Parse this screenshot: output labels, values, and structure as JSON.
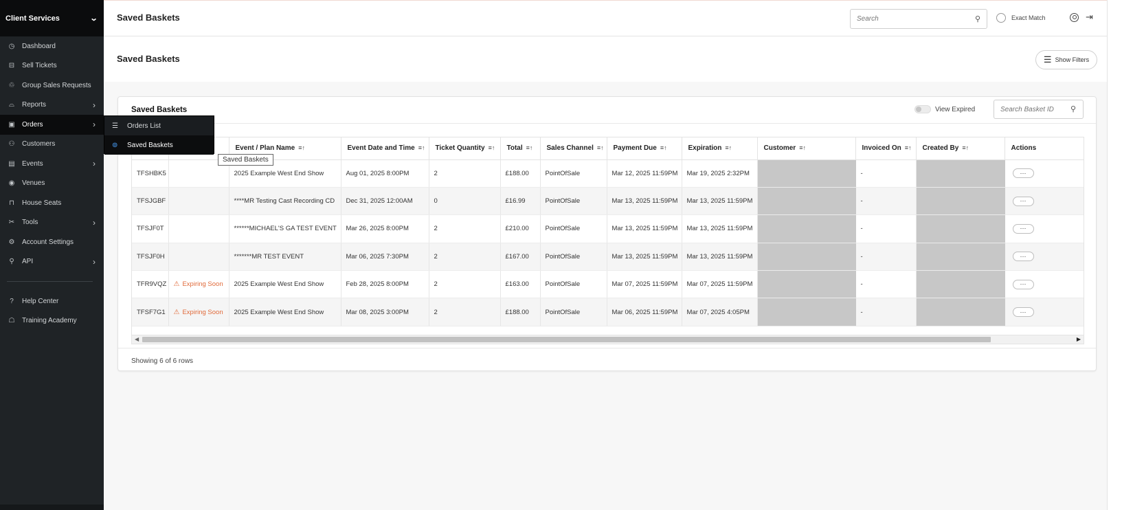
{
  "sidebar": {
    "header": "Client Services",
    "items": [
      {
        "label": "Dashboard",
        "icon": "dashboard-icon",
        "glyph": "◷",
        "arrow": false
      },
      {
        "label": "Sell Tickets",
        "icon": "ticket-icon",
        "glyph": "⊟",
        "arrow": false
      },
      {
        "label": "Group Sales Requests",
        "icon": "group-icon",
        "glyph": "♲",
        "arrow": false
      },
      {
        "label": "Reports",
        "icon": "chart-icon",
        "glyph": "⌓",
        "arrow": true
      },
      {
        "label": "Orders",
        "icon": "orders-icon",
        "glyph": "▣",
        "arrow": true,
        "active": true
      },
      {
        "label": "Customers",
        "icon": "customers-icon",
        "glyph": "⚇",
        "arrow": false
      },
      {
        "label": "Events",
        "icon": "calendar-icon",
        "glyph": "▤",
        "arrow": true
      },
      {
        "label": "Venues",
        "icon": "venue-icon",
        "glyph": "◉",
        "arrow": false
      },
      {
        "label": "House Seats",
        "icon": "seat-icon",
        "glyph": "⊓",
        "arrow": false
      },
      {
        "label": "Tools",
        "icon": "tools-icon",
        "glyph": "✂",
        "arrow": true
      },
      {
        "label": "Account Settings",
        "icon": "settings-icon",
        "glyph": "⚙",
        "arrow": false
      },
      {
        "label": "API",
        "icon": "api-icon",
        "glyph": "⚲",
        "arrow": true
      }
    ],
    "footer_items": [
      {
        "label": "Help Center",
        "icon": "help-icon",
        "glyph": "?"
      },
      {
        "label": "Training Academy",
        "icon": "academy-icon",
        "glyph": "☖"
      }
    ]
  },
  "flyout": {
    "items": [
      {
        "label": "Orders List",
        "icon": "list-icon"
      },
      {
        "label": "Saved Baskets",
        "icon": "basket-icon",
        "active": true
      }
    ],
    "tooltip": "Saved Baskets"
  },
  "topbar": {
    "title": "Saved Baskets",
    "search_placeholder": "Search",
    "exact_match": "Exact Match"
  },
  "page": {
    "title": "Saved Baskets",
    "show_filters": "Show Filters"
  },
  "card": {
    "title": "Saved Baskets",
    "view_expired": "View Expired",
    "search_placeholder": "Search Basket ID",
    "rows_text": "Showing 6 of 6 rows"
  },
  "table": {
    "columns": [
      "",
      "",
      "Event / Plan Name",
      "Event Date and Time",
      "Ticket Quantity",
      "Total",
      "Sales Channel",
      "Payment Due",
      "Expiration",
      "Customer",
      "Invoiced On",
      "Created By",
      "Actions"
    ],
    "rows": [
      {
        "id": "TFSHBK5",
        "status": "",
        "event": "2025 Example West End Show",
        "date": "Aug 01, 2025 8:00PM",
        "qty": "2",
        "total": "£188.00",
        "channel": "PointOfSale",
        "due": "Mar 12, 2025 11:59PM",
        "expiration": "Mar 19, 2025 2:32PM",
        "invoiced": "-"
      },
      {
        "id": "TFSJGBF",
        "status": "",
        "event": "****MR Testing Cast Recording CD",
        "date": "Dec 31, 2025 12:00AM",
        "qty": "0",
        "total": "£16.99",
        "channel": "PointOfSale",
        "due": "Mar 13, 2025 11:59PM",
        "expiration": "Mar 13, 2025 11:59PM",
        "invoiced": "-"
      },
      {
        "id": "TFSJF0T",
        "status": "",
        "event": "******MICHAEL'S GA TEST EVENT",
        "date": "Mar 26, 2025 8:00PM",
        "qty": "2",
        "total": "£210.00",
        "channel": "PointOfSale",
        "due": "Mar 13, 2025 11:59PM",
        "expiration": "Mar 13, 2025 11:59PM",
        "invoiced": "-"
      },
      {
        "id": "TFSJF0H",
        "status": "",
        "event": "*******MR TEST EVENT",
        "date": "Mar 06, 2025 7:30PM",
        "qty": "2",
        "total": "£167.00",
        "channel": "PointOfSale",
        "due": "Mar 13, 2025 11:59PM",
        "expiration": "Mar 13, 2025 11:59PM",
        "invoiced": "-"
      },
      {
        "id": "TFR9VQZ",
        "status": "Expiring Soon",
        "event": "2025 Example West End Show",
        "date": "Feb 28, 2025 8:00PM",
        "qty": "2",
        "total": "£163.00",
        "channel": "PointOfSale",
        "due": "Mar 07, 2025 11:59PM",
        "expiration": "Mar 07, 2025 11:59PM",
        "invoiced": "-"
      },
      {
        "id": "TFSF7G1",
        "status": "Expiring Soon",
        "event": "2025 Example West End Show",
        "date": "Mar 08, 2025 3:00PM",
        "qty": "2",
        "total": "£188.00",
        "channel": "PointOfSale",
        "due": "Mar 06, 2025 11:59PM",
        "expiration": "Mar 07, 2025 4:05PM",
        "invoiced": "-"
      }
    ],
    "action_label": "···"
  },
  "colors": {
    "sidebar_bg": "#1f2326",
    "sidebar_active": "#0b0c0d",
    "expiring": "#e06a3a",
    "redacted": "#c7c7c7"
  }
}
